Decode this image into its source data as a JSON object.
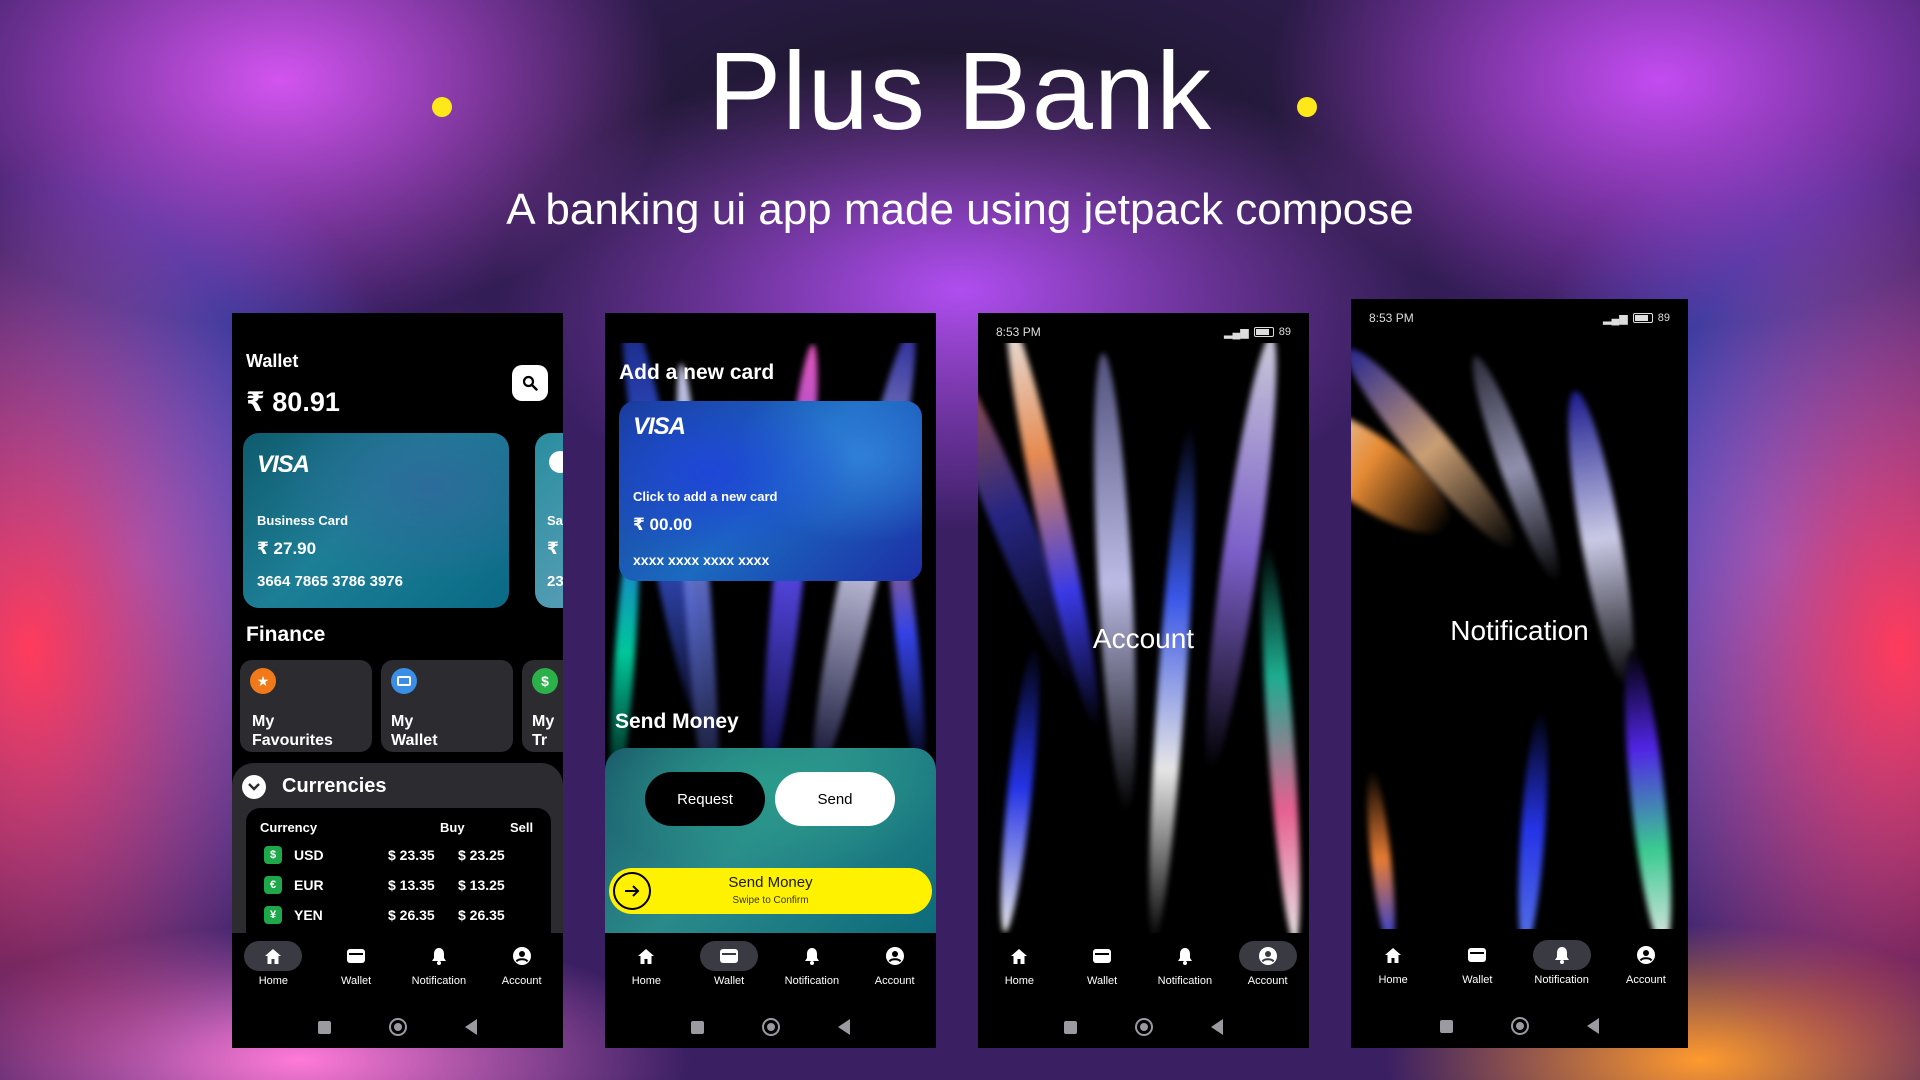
{
  "header": {
    "title": "Plus Bank",
    "subtitle": "A banking ui app made using jetpack compose",
    "accent": "#ffe81a"
  },
  "nav": [
    {
      "label": "Home",
      "icon": "home-icon"
    },
    {
      "label": "Wallet",
      "icon": "wallet-icon"
    },
    {
      "label": "Notification",
      "icon": "bell-icon"
    },
    {
      "label": "Account",
      "icon": "account-circle-icon"
    }
  ],
  "screen1": {
    "title": "Wallet",
    "balance": "₹ 80.91",
    "card": {
      "brand": "VISA",
      "name": "Business Card",
      "amount": "₹ 27.90",
      "number": "3664 7865 3786 3976"
    },
    "card_peek": {
      "name": "Sa",
      "amount": "₹",
      "number": "23"
    },
    "finance_title": "Finance",
    "finance": [
      {
        "line1": "My",
        "line2": "Favourites",
        "icon": "star-icon",
        "color": "#f07a1a"
      },
      {
        "line1": "My",
        "line2": "Wallet",
        "icon": "wallet-icon",
        "color": "#3a8ee6"
      },
      {
        "line1": "My",
        "line2": "Tr",
        "icon": "dollar-icon",
        "color": "#2bb04a"
      }
    ],
    "currencies_title": "Currencies",
    "currency_headers": {
      "currency": "Currency",
      "buy": "Buy",
      "sell": "Sell"
    },
    "currencies": [
      {
        "symbol": "$",
        "name": "USD",
        "buy": "$ 23.35",
        "sell": "$ 23.25"
      },
      {
        "symbol": "€",
        "name": "EUR",
        "buy": "$ 13.35",
        "sell": "$ 13.25"
      },
      {
        "symbol": "¥",
        "name": "YEN",
        "buy": "$ 26.35",
        "sell": "$ 26.35"
      }
    ],
    "active_nav": "Home"
  },
  "screen2": {
    "title": "Add a new card",
    "card": {
      "brand": "VISA",
      "hint": "Click to add a new card",
      "amount": "₹ 00.00",
      "number": "xxxx xxxx xxxx xxxx"
    },
    "send_title": "Send Money",
    "request_label": "Request",
    "send_label": "Send",
    "swipe_title": "Send Money",
    "swipe_sub": "Swipe to Confirm",
    "active_nav": "Wallet"
  },
  "screen3": {
    "time": "8:53 PM",
    "battery": "89",
    "label": "Account",
    "active_nav": "Account"
  },
  "screen4": {
    "time": "8:53 PM",
    "battery": "89",
    "label": "Notification",
    "active_nav": "Notification"
  }
}
